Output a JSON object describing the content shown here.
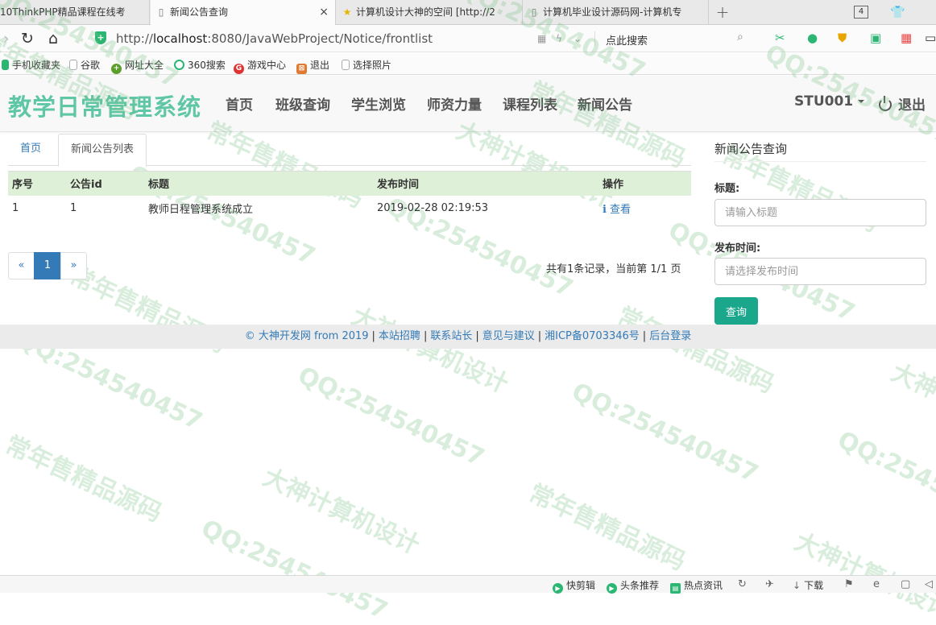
{
  "browser": {
    "tabs": [
      {
        "title": "10ThinkPHP精品课程在线考",
        "active": false,
        "icon": "page-icon"
      },
      {
        "title": "新闻公告查询",
        "active": true,
        "icon": "page-icon",
        "close": "×"
      },
      {
        "title": "计算机设计大神的空间 [http://2",
        "active": false,
        "icon": "star-icon"
      },
      {
        "title": "计算机毕业设计源码网-计算机专",
        "active": false,
        "icon": "page-icon"
      }
    ],
    "new_tab": "+",
    "tab_count": "4",
    "url_prefix": "http://",
    "url_host": "localhost",
    "url_rest": ":8080/JavaWebProject/Notice/frontlist",
    "search_hint": "点此搜索",
    "bookmarks": [
      "手机收藏夹",
      "谷歌",
      "网址大全",
      "360搜索",
      "游戏中心",
      "退出",
      "选择照片"
    ]
  },
  "site": {
    "brand": "教学日常管理系统",
    "nav": [
      "首页",
      "班级查询",
      "学生浏览",
      "师资力量",
      "课程列表",
      "新闻公告"
    ],
    "user": "STU001",
    "logout": "退出"
  },
  "main": {
    "tabs": {
      "home": "首页",
      "current": "新闻公告列表"
    },
    "columns": [
      "序号",
      "公告id",
      "标题",
      "发布时间",
      "操作"
    ],
    "rows": [
      {
        "index": "1",
        "id": "1",
        "title": "教师日程管理系统成立",
        "time": "2019-02-28 02:19:53",
        "action": "查看",
        "action_icon": "i"
      }
    ],
    "pager": {
      "prev": "«",
      "current": "1",
      "next": "»"
    },
    "page_info": "共有1条记录，当前第 1/1 页"
  },
  "sidebar": {
    "title": "新闻公告查询",
    "title_label": "标题:",
    "title_placeholder": "请输入标题",
    "time_label": "发布时间:",
    "time_placeholder": "请选择发布时间",
    "query_button": "查询"
  },
  "footer": {
    "copyright": "© 大神开发网 from 2019",
    "links": [
      "本站招聘",
      "联系站长",
      "意见与建议",
      "湘ICP备0703346号",
      "后台登录"
    ]
  },
  "watermarks": [
    "QQ:254540457",
    "常年售精品源码",
    "大神计算机设计"
  ],
  "statusbar": {
    "items": [
      "快剪辑",
      "头条推荐",
      "热点资讯",
      "下载"
    ]
  },
  "colors": {
    "brand": "#5fc7a5",
    "link": "#337ab7",
    "table_header": "#dff0d8",
    "button": "#1aa78b"
  }
}
